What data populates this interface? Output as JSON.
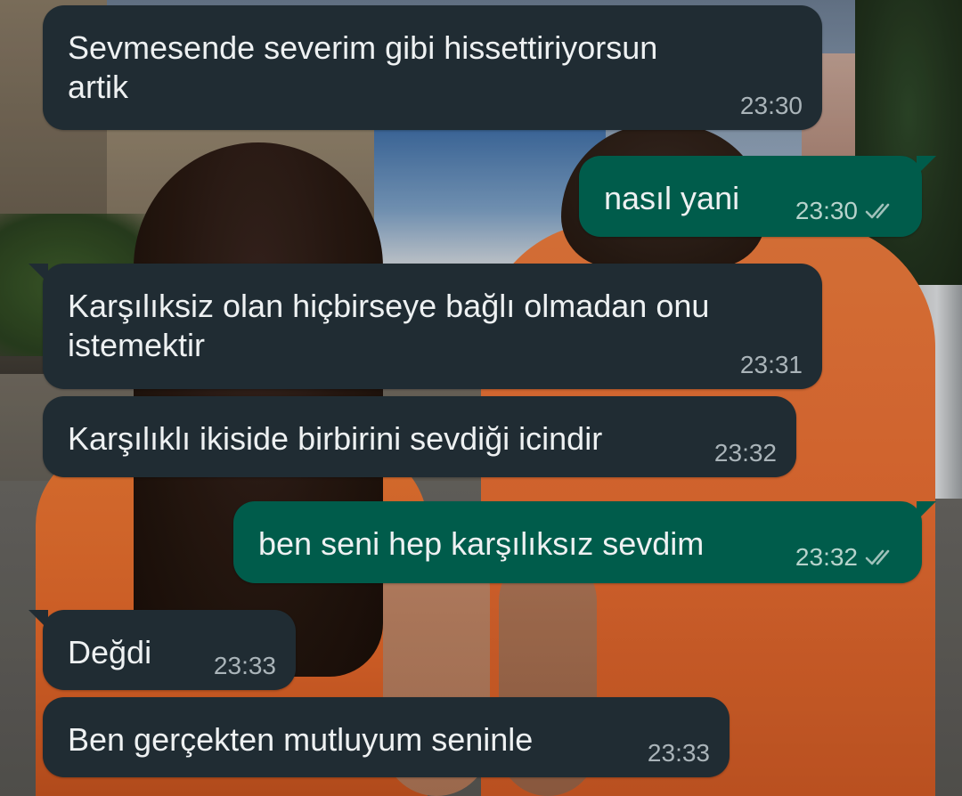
{
  "colors": {
    "incoming_bubble": "#202c33",
    "outgoing_bubble": "#005c4b",
    "text": "#eef1f2",
    "timestamp": "#aab4b9",
    "read_ticks": "#9fc1ba"
  },
  "icons": {
    "read_receipt": "double-check-icon"
  },
  "messages": [
    {
      "direction": "incoming",
      "text": "Sevmesende severim gibi hissettiriyorsun\nartik",
      "time": "23:30"
    },
    {
      "direction": "outgoing",
      "text": "nasıl yani",
      "time": "23:30",
      "status": "read"
    },
    {
      "direction": "incoming",
      "text": "Karşılıksiz olan hiçbirseye bağlı olmadan onu\nistemektir",
      "time": "23:31"
    },
    {
      "direction": "incoming",
      "text": "Karşılıklı ikiside birbirini sevdiği icindir",
      "time": "23:32"
    },
    {
      "direction": "outgoing",
      "text": "ben seni hep karşılıksız sevdim",
      "time": "23:32",
      "status": "read"
    },
    {
      "direction": "incoming",
      "text": "Değdi",
      "time": "23:33"
    },
    {
      "direction": "incoming",
      "text": "Ben gerçekten mutluyum seninle",
      "time": "23:33"
    }
  ]
}
